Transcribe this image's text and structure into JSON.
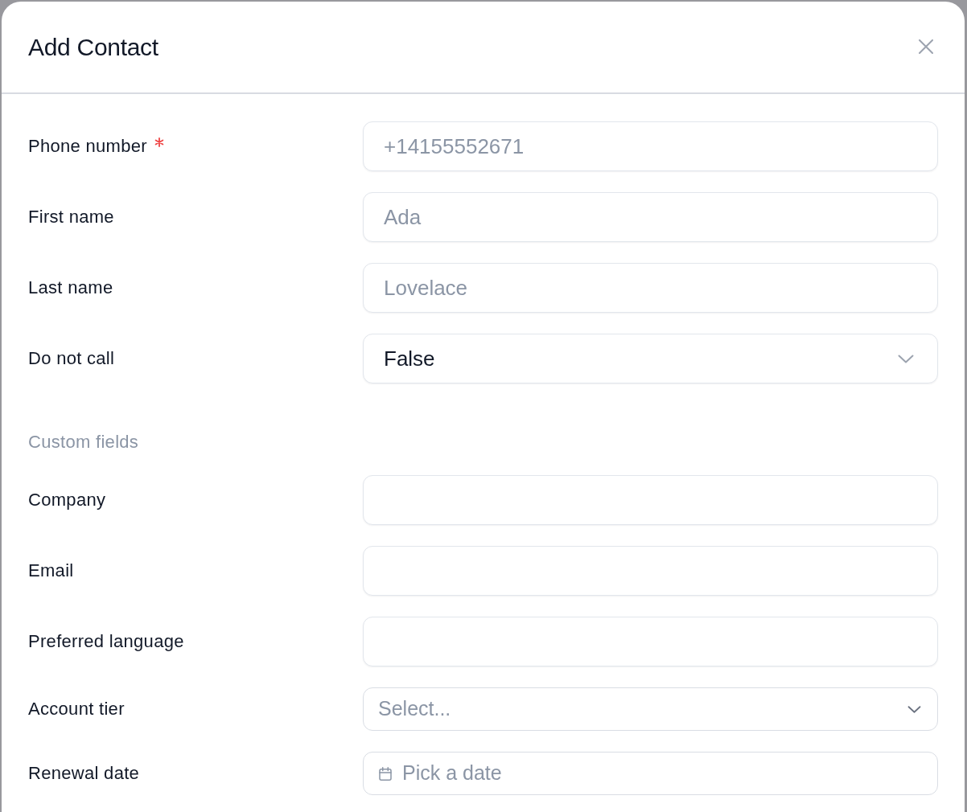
{
  "dialog": {
    "title": "Add Contact"
  },
  "fields": [
    {
      "kind": "text",
      "label": "Phone number",
      "required": true,
      "placeholder": "+14155552671"
    },
    {
      "kind": "text",
      "label": "First name",
      "required": false,
      "placeholder": "Ada"
    },
    {
      "kind": "text",
      "label": "Last name",
      "required": false,
      "placeholder": "Lovelace"
    },
    {
      "kind": "select",
      "label": "Do not call",
      "required": false,
      "value": "False"
    }
  ],
  "custom_fields": {
    "heading": "Custom fields",
    "fields": [
      {
        "kind": "text",
        "label": "Company",
        "required": false
      },
      {
        "kind": "text",
        "label": "Email",
        "required": false
      },
      {
        "kind": "text",
        "label": "Preferred language",
        "required": false
      },
      {
        "kind": "combobox",
        "label": "Account tier",
        "required": false,
        "placeholder": "Select..."
      },
      {
        "kind": "date",
        "label": "Renewal date",
        "required": false,
        "placeholder": "Pick a date"
      }
    ]
  }
}
